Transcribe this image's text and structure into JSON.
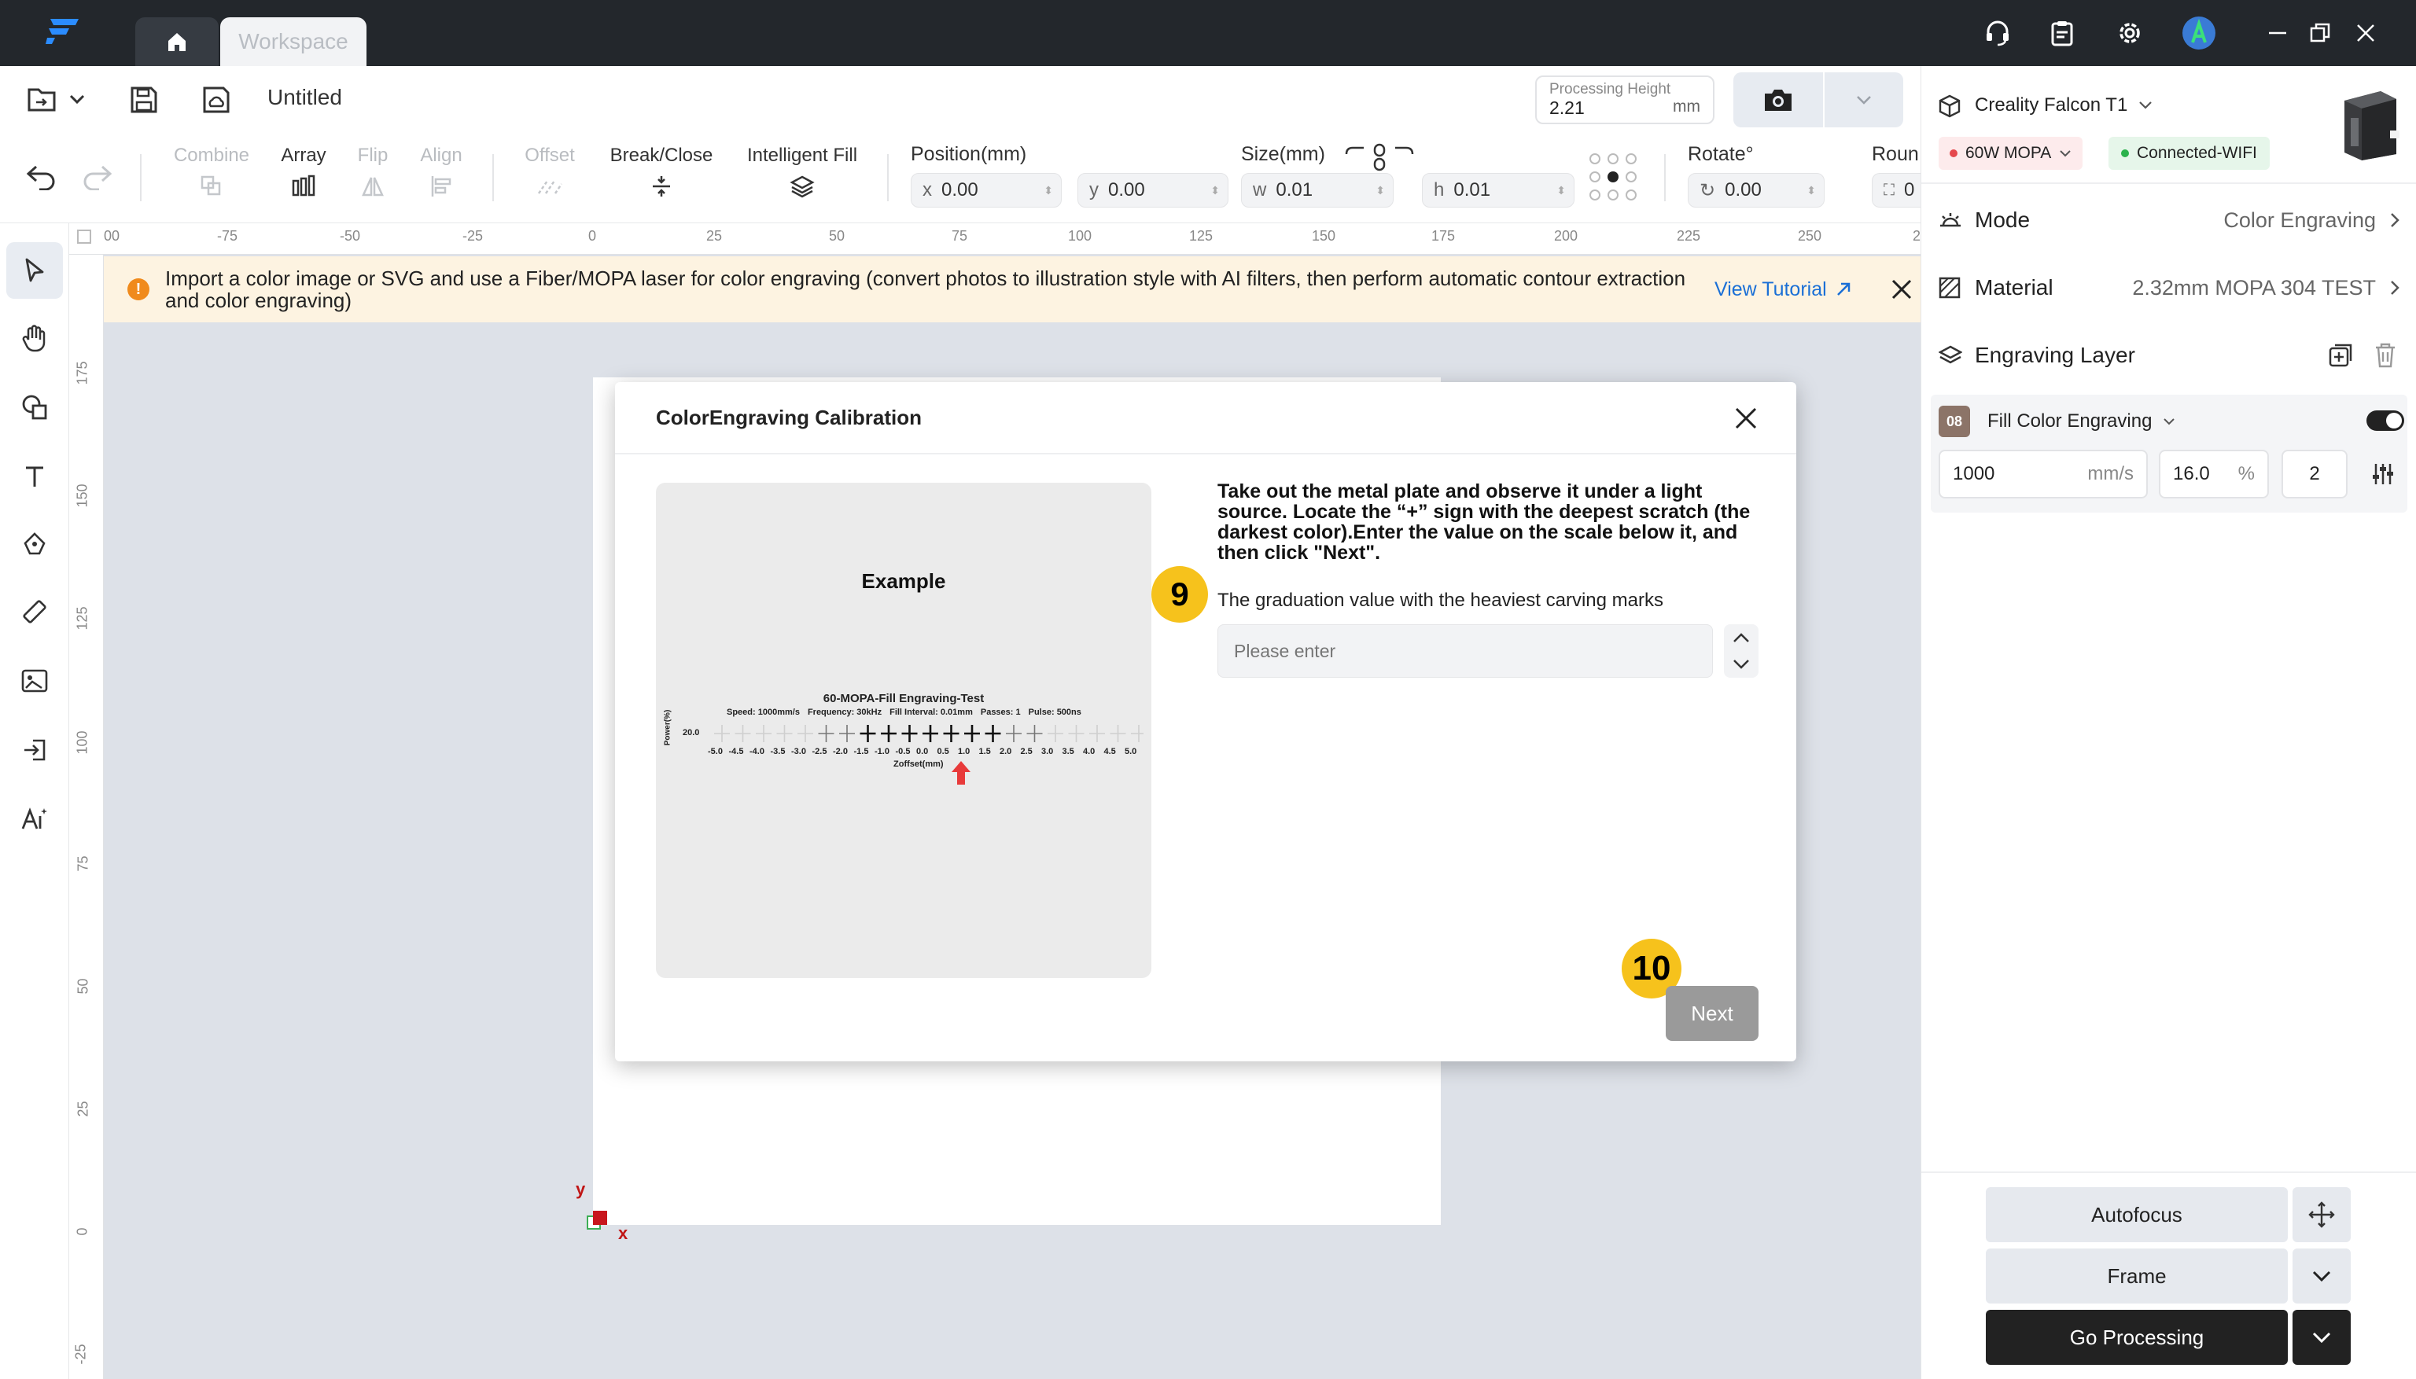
{
  "titlebar": {
    "workspace_tab": "Workspace"
  },
  "filebar": {
    "doc_title": "Untitled",
    "processing_height_label": "Processing Height",
    "processing_height_value": "2.21",
    "processing_height_unit": "mm"
  },
  "toolbar": {
    "combine": "Combine",
    "array": "Array",
    "flip": "Flip",
    "align": "Align",
    "offset": "Offset",
    "break_close": "Break/Close",
    "intelligent_fill": "Intelligent Fill",
    "position_label": "Position(mm)",
    "x_prefix": "x",
    "x_value": "0.00",
    "y_prefix": "y",
    "y_value": "0.00",
    "size_label": "Size(mm)",
    "w_prefix": "w",
    "w_value": "0.01",
    "h_prefix": "h",
    "h_value": "0.01",
    "rotate_label": "Rotate°",
    "rotate_value": "0.00",
    "round_label": "Roun",
    "round_value": "0"
  },
  "ruler": {
    "top": [
      "00",
      "-75",
      "-50",
      "-25",
      "0",
      "25",
      "50",
      "75",
      "100",
      "125",
      "150",
      "175",
      "200",
      "225",
      "250",
      "2"
    ],
    "left": [
      "175",
      "150",
      "125",
      "100",
      "75",
      "50",
      "25",
      "0",
      "-25"
    ]
  },
  "banner": {
    "text": "Import a color image or SVG and use a Fiber/MOPA laser for color engraving (convert photos to illustration style with AI filters, then perform automatic contour extraction and color engraving)",
    "link": "View Tutorial"
  },
  "origin": {
    "x": "x",
    "y": "y"
  },
  "modal": {
    "title": "ColorEngraving Calibration",
    "example_title": "Example",
    "test_title": "60-MOPA-Fill Engraving-Test",
    "test_params": [
      "Speed: 1000mm/s",
      "Frequency: 30kHz",
      "Fill Interval: 0.01mm",
      "Passes: 1",
      "Pulse: 500ns"
    ],
    "power_label": "Power(%)",
    "power_value": "20.0",
    "scale": [
      "-5.0",
      "-4.5",
      "-4.0",
      "-3.5",
      "-3.0",
      "-2.5",
      "-2.0",
      "-1.5",
      "-1.0",
      "-0.5",
      "0.0",
      "0.5",
      "1.0",
      "1.5",
      "2.0",
      "2.5",
      "3.0",
      "3.5",
      "4.0",
      "4.5",
      "5.0"
    ],
    "zoffset_label": "Zoffset(mm)",
    "instruction": "Take out the metal plate and observe it under a light source. Locate the “+” sign with the deepest scratch (the darkest color).Enter the value on the scale below it, and then click \"Next\".",
    "step_9": "9",
    "step_10": "10",
    "field_label": "The graduation value with the heaviest carving marks",
    "input_placeholder": "Please enter",
    "next": "Next"
  },
  "right_panel": {
    "device": "Creality Falcon T1",
    "laser": "60W MOPA",
    "connection": "Connected-WIFI",
    "mode_label": "Mode",
    "mode_value": "Color Engraving",
    "material_label": "Material",
    "material_value": "2.32mm MOPA 304 TEST",
    "layer_label": "Engraving Layer",
    "layer_index": "08",
    "layer_name": "Fill Color Engraving",
    "speed": "1000",
    "speed_unit": "mm/s",
    "power": "16.0",
    "power_unit": "%",
    "passes": "2",
    "autofocus": "Autofocus",
    "frame": "Frame",
    "go": "Go Processing"
  },
  "colors": {
    "accent": "#1a6fd6",
    "badge": "#f6c21c",
    "titlebar": "#23272c",
    "banner_bg": "#fdf3e1"
  }
}
